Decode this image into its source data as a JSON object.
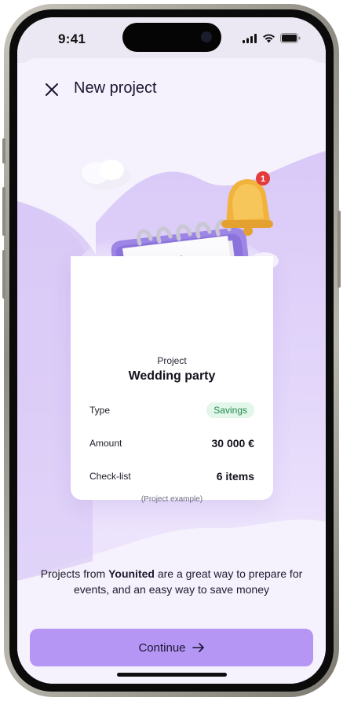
{
  "status_bar": {
    "time": "9:41"
  },
  "header": {
    "title": "New project"
  },
  "card": {
    "label": "Project",
    "title": "Wedding party",
    "rows": [
      {
        "label": "Type",
        "value": "Savings"
      },
      {
        "label": "Amount",
        "value": "30 000 €"
      },
      {
        "label": "Check-list",
        "value": "6 items"
      }
    ],
    "note": "(Project example)"
  },
  "notification": {
    "count": "1"
  },
  "description": {
    "prefix": "Projects from ",
    "brand": "Younited",
    "suffix": " are a great way to prepare for events, and an easy way to save money"
  },
  "continue_button": {
    "label": "Continue"
  },
  "colors": {
    "accent": "#b696f5",
    "background": "#f5f1fd",
    "badge_text": "#1e8a4c",
    "badge_bg": "#e3f6ea"
  },
  "icons": {
    "close": "close-icon",
    "arrow": "arrow-right-icon",
    "signal": "cellular-signal-icon",
    "wifi": "wifi-icon",
    "battery": "battery-icon",
    "illustration": "notepad-pencil-bell-illustration"
  }
}
